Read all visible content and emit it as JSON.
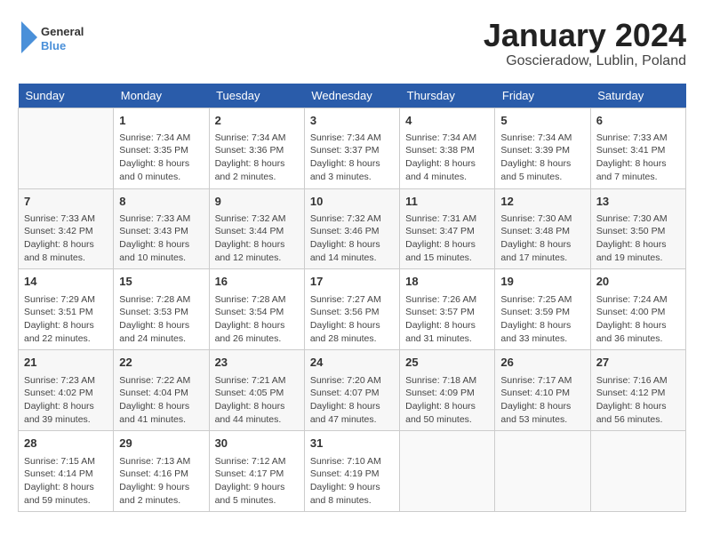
{
  "header": {
    "logo_line1": "General",
    "logo_line2": "Blue",
    "month_title": "January 2024",
    "location": "Goscieradow, Lublin, Poland"
  },
  "days_of_week": [
    "Sunday",
    "Monday",
    "Tuesday",
    "Wednesday",
    "Thursday",
    "Friday",
    "Saturday"
  ],
  "weeks": [
    [
      {
        "day": "",
        "info": ""
      },
      {
        "day": "1",
        "info": "Sunrise: 7:34 AM\nSunset: 3:35 PM\nDaylight: 8 hours\nand 0 minutes."
      },
      {
        "day": "2",
        "info": "Sunrise: 7:34 AM\nSunset: 3:36 PM\nDaylight: 8 hours\nand 2 minutes."
      },
      {
        "day": "3",
        "info": "Sunrise: 7:34 AM\nSunset: 3:37 PM\nDaylight: 8 hours\nand 3 minutes."
      },
      {
        "day": "4",
        "info": "Sunrise: 7:34 AM\nSunset: 3:38 PM\nDaylight: 8 hours\nand 4 minutes."
      },
      {
        "day": "5",
        "info": "Sunrise: 7:34 AM\nSunset: 3:39 PM\nDaylight: 8 hours\nand 5 minutes."
      },
      {
        "day": "6",
        "info": "Sunrise: 7:33 AM\nSunset: 3:41 PM\nDaylight: 8 hours\nand 7 minutes."
      }
    ],
    [
      {
        "day": "7",
        "info": "Sunrise: 7:33 AM\nSunset: 3:42 PM\nDaylight: 8 hours\nand 8 minutes."
      },
      {
        "day": "8",
        "info": "Sunrise: 7:33 AM\nSunset: 3:43 PM\nDaylight: 8 hours\nand 10 minutes."
      },
      {
        "day": "9",
        "info": "Sunrise: 7:32 AM\nSunset: 3:44 PM\nDaylight: 8 hours\nand 12 minutes."
      },
      {
        "day": "10",
        "info": "Sunrise: 7:32 AM\nSunset: 3:46 PM\nDaylight: 8 hours\nand 14 minutes."
      },
      {
        "day": "11",
        "info": "Sunrise: 7:31 AM\nSunset: 3:47 PM\nDaylight: 8 hours\nand 15 minutes."
      },
      {
        "day": "12",
        "info": "Sunrise: 7:30 AM\nSunset: 3:48 PM\nDaylight: 8 hours\nand 17 minutes."
      },
      {
        "day": "13",
        "info": "Sunrise: 7:30 AM\nSunset: 3:50 PM\nDaylight: 8 hours\nand 19 minutes."
      }
    ],
    [
      {
        "day": "14",
        "info": "Sunrise: 7:29 AM\nSunset: 3:51 PM\nDaylight: 8 hours\nand 22 minutes."
      },
      {
        "day": "15",
        "info": "Sunrise: 7:28 AM\nSunset: 3:53 PM\nDaylight: 8 hours\nand 24 minutes."
      },
      {
        "day": "16",
        "info": "Sunrise: 7:28 AM\nSunset: 3:54 PM\nDaylight: 8 hours\nand 26 minutes."
      },
      {
        "day": "17",
        "info": "Sunrise: 7:27 AM\nSunset: 3:56 PM\nDaylight: 8 hours\nand 28 minutes."
      },
      {
        "day": "18",
        "info": "Sunrise: 7:26 AM\nSunset: 3:57 PM\nDaylight: 8 hours\nand 31 minutes."
      },
      {
        "day": "19",
        "info": "Sunrise: 7:25 AM\nSunset: 3:59 PM\nDaylight: 8 hours\nand 33 minutes."
      },
      {
        "day": "20",
        "info": "Sunrise: 7:24 AM\nSunset: 4:00 PM\nDaylight: 8 hours\nand 36 minutes."
      }
    ],
    [
      {
        "day": "21",
        "info": "Sunrise: 7:23 AM\nSunset: 4:02 PM\nDaylight: 8 hours\nand 39 minutes."
      },
      {
        "day": "22",
        "info": "Sunrise: 7:22 AM\nSunset: 4:04 PM\nDaylight: 8 hours\nand 41 minutes."
      },
      {
        "day": "23",
        "info": "Sunrise: 7:21 AM\nSunset: 4:05 PM\nDaylight: 8 hours\nand 44 minutes."
      },
      {
        "day": "24",
        "info": "Sunrise: 7:20 AM\nSunset: 4:07 PM\nDaylight: 8 hours\nand 47 minutes."
      },
      {
        "day": "25",
        "info": "Sunrise: 7:18 AM\nSunset: 4:09 PM\nDaylight: 8 hours\nand 50 minutes."
      },
      {
        "day": "26",
        "info": "Sunrise: 7:17 AM\nSunset: 4:10 PM\nDaylight: 8 hours\nand 53 minutes."
      },
      {
        "day": "27",
        "info": "Sunrise: 7:16 AM\nSunset: 4:12 PM\nDaylight: 8 hours\nand 56 minutes."
      }
    ],
    [
      {
        "day": "28",
        "info": "Sunrise: 7:15 AM\nSunset: 4:14 PM\nDaylight: 8 hours\nand 59 minutes."
      },
      {
        "day": "29",
        "info": "Sunrise: 7:13 AM\nSunset: 4:16 PM\nDaylight: 9 hours\nand 2 minutes."
      },
      {
        "day": "30",
        "info": "Sunrise: 7:12 AM\nSunset: 4:17 PM\nDaylight: 9 hours\nand 5 minutes."
      },
      {
        "day": "31",
        "info": "Sunrise: 7:10 AM\nSunset: 4:19 PM\nDaylight: 9 hours\nand 8 minutes."
      },
      {
        "day": "",
        "info": ""
      },
      {
        "day": "",
        "info": ""
      },
      {
        "day": "",
        "info": ""
      }
    ]
  ]
}
